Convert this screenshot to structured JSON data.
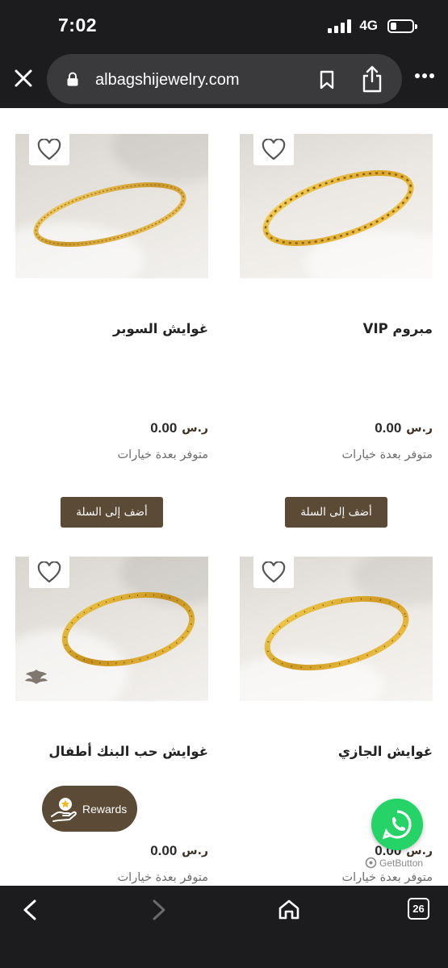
{
  "status_bar": {
    "time": "7:02",
    "network": "4G",
    "battery_level": 0.25
  },
  "browser": {
    "url": "albagshijewelry.com"
  },
  "products": [
    {
      "name": "غوايش السوبر",
      "price": "0.00",
      "availability": "متوفر بعدة خيارات",
      "button": "أضف إلى السلة"
    },
    {
      "name": "مبروم VIP",
      "price": "0.00",
      "availability": "متوفر بعدة خيارات",
      "button": "أضف إلى السلة"
    },
    {
      "name": "غوايش حب البنك  أطفال",
      "price": "0.00",
      "availability": "متوفر بعدة خيارات",
      "logo_text": "البقشي"
    },
    {
      "name": "غوايش الجازي",
      "price": "0.00",
      "availability": "متوفر بعدة خيارات"
    }
  ],
  "currency_symbol": "ر.س",
  "rewards": {
    "label": "Rewards"
  },
  "getbutton": {
    "label": "GetButton"
  },
  "toolbar": {
    "tab_count": "26"
  },
  "colors": {
    "accent": "#5b4a35",
    "whatsapp": "#25d366",
    "chrome": "#1c1c1e"
  }
}
